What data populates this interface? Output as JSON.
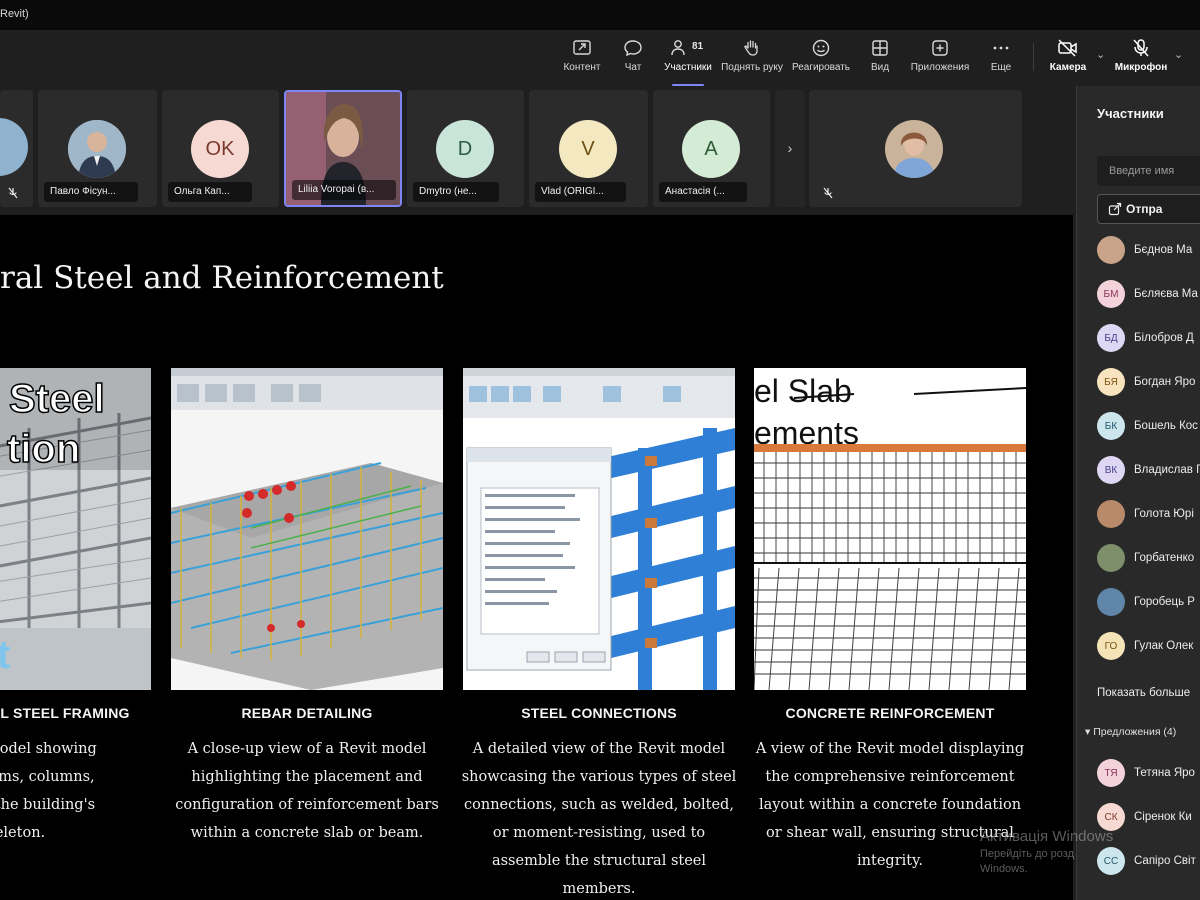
{
  "window": {
    "title": "Revit)"
  },
  "toolbar": {
    "participants_count": "81",
    "buttons": [
      {
        "label": "Контент",
        "icon": "share-screen-icon"
      },
      {
        "label": "Чат",
        "icon": "chat-icon"
      },
      {
        "label": "Участники",
        "icon": "people-icon"
      },
      {
        "label": "Поднять руку",
        "icon": "raise-hand-icon"
      },
      {
        "label": "Реагировать",
        "icon": "emoji-icon"
      },
      {
        "label": "Вид",
        "icon": "grid-view-icon"
      },
      {
        "label": "Приложения",
        "icon": "apps-icon"
      },
      {
        "label": "Еще",
        "icon": "more-icon"
      },
      {
        "label": "Камера",
        "icon": "camera-off-icon"
      },
      {
        "label": "Микрофон",
        "icon": "mic-off-icon"
      }
    ]
  },
  "video_strip": [
    {
      "name": "",
      "type": "photo"
    },
    {
      "name": "Павло Фісун...",
      "type": "photo"
    },
    {
      "name": "Ольга Кап...",
      "type": "initials",
      "initials": "OK",
      "color": "#f6d9d2"
    },
    {
      "name": "Liliia Voropai (в...",
      "type": "photo",
      "selected": true
    },
    {
      "name": "Dmytro (не...",
      "type": "initials",
      "initials": "D",
      "color": "#c9e4d9"
    },
    {
      "name": "Vlad (ORIGI...",
      "type": "initials",
      "initials": "V",
      "color": "#f4e8c1"
    },
    {
      "name": "Анастасія (...",
      "type": "initials",
      "initials": "A",
      "color": "#d4ebd6"
    },
    {
      "name": "",
      "type": "photo"
    }
  ],
  "slide": {
    "title": "ral Steel and Reinforcement",
    "cards": [
      {
        "heading": "L STEEL FRAMING",
        "image_text": [
          "Steel",
          "tion",
          "t"
        ],
        "lines": [
          "Revit model showing",
          "eel beams, columns,",
          "t form the building's",
          "eleton."
        ]
      },
      {
        "heading": "REBAR DETAILING",
        "lines": [
          "A close-up view of a Revit model",
          "highlighting the placement and",
          "configuration of reinforcement bars",
          "within a concrete slab or beam."
        ]
      },
      {
        "heading": "STEEL CONNECTIONS",
        "lines": [
          "A detailed view of the Revit model",
          "showcasing the various types of steel",
          "connections, such as welded, bolted,",
          "or moment-resisting, used to",
          "assemble the structural steel",
          "members."
        ]
      },
      {
        "heading": "CONCRETE REINFORCEMENT",
        "image_text": [
          "el Slab",
          "ements"
        ],
        "lines": [
          "A view of the Revit model displaying",
          "the comprehensive reinforcement",
          "layout within a concrete foundation",
          "or shear wall, ensuring structural",
          "integrity."
        ]
      }
    ]
  },
  "participants_pane": {
    "title": "Участники",
    "search_placeholder": "Введите имя",
    "share_label": "Отпра",
    "people": [
      {
        "name": "Бєднов Ма",
        "initials": "",
        "color": "#c9a48a"
      },
      {
        "name": "Бєляєва Ма",
        "initials": "БМ",
        "color": "#f4d2dc"
      },
      {
        "name": "Білобров Д",
        "initials": "БД",
        "color": "#dcd7f3"
      },
      {
        "name": "Богдан Яро",
        "initials": "БЯ",
        "color": "#f7e3bd"
      },
      {
        "name": "Бошель Кос",
        "initials": "БК",
        "color": "#cde6ee"
      },
      {
        "name": "Владислав Г",
        "initials": "ВК",
        "color": "#ded7f3"
      },
      {
        "name": "Голота Юрі",
        "initials": "",
        "color": "#b88a6a"
      },
      {
        "name": "Горбатенко",
        "initials": "",
        "color": "#7d8f6b"
      },
      {
        "name": "Горобець Р",
        "initials": "",
        "color": "#5f86a8"
      },
      {
        "name": "Гулак Олек",
        "initials": "ГО",
        "color": "#f5e3b8"
      }
    ],
    "show_more": "Показать больше",
    "suggestions_label": "Предложения (4)",
    "suggested": [
      {
        "name": "Тетяна Яро",
        "initials": "ТЯ",
        "color": "#f4d2dc"
      },
      {
        "name": "Сіренок Ки",
        "initials": "СК",
        "color": "#f6d9d2"
      },
      {
        "name": "Сапіро Світ",
        "initials": "СС",
        "color": "#cde6ee"
      }
    ]
  },
  "watermark": {
    "line1": "Активація Windows",
    "line2": "Перейдіть до розд",
    "line3": "Windows."
  }
}
